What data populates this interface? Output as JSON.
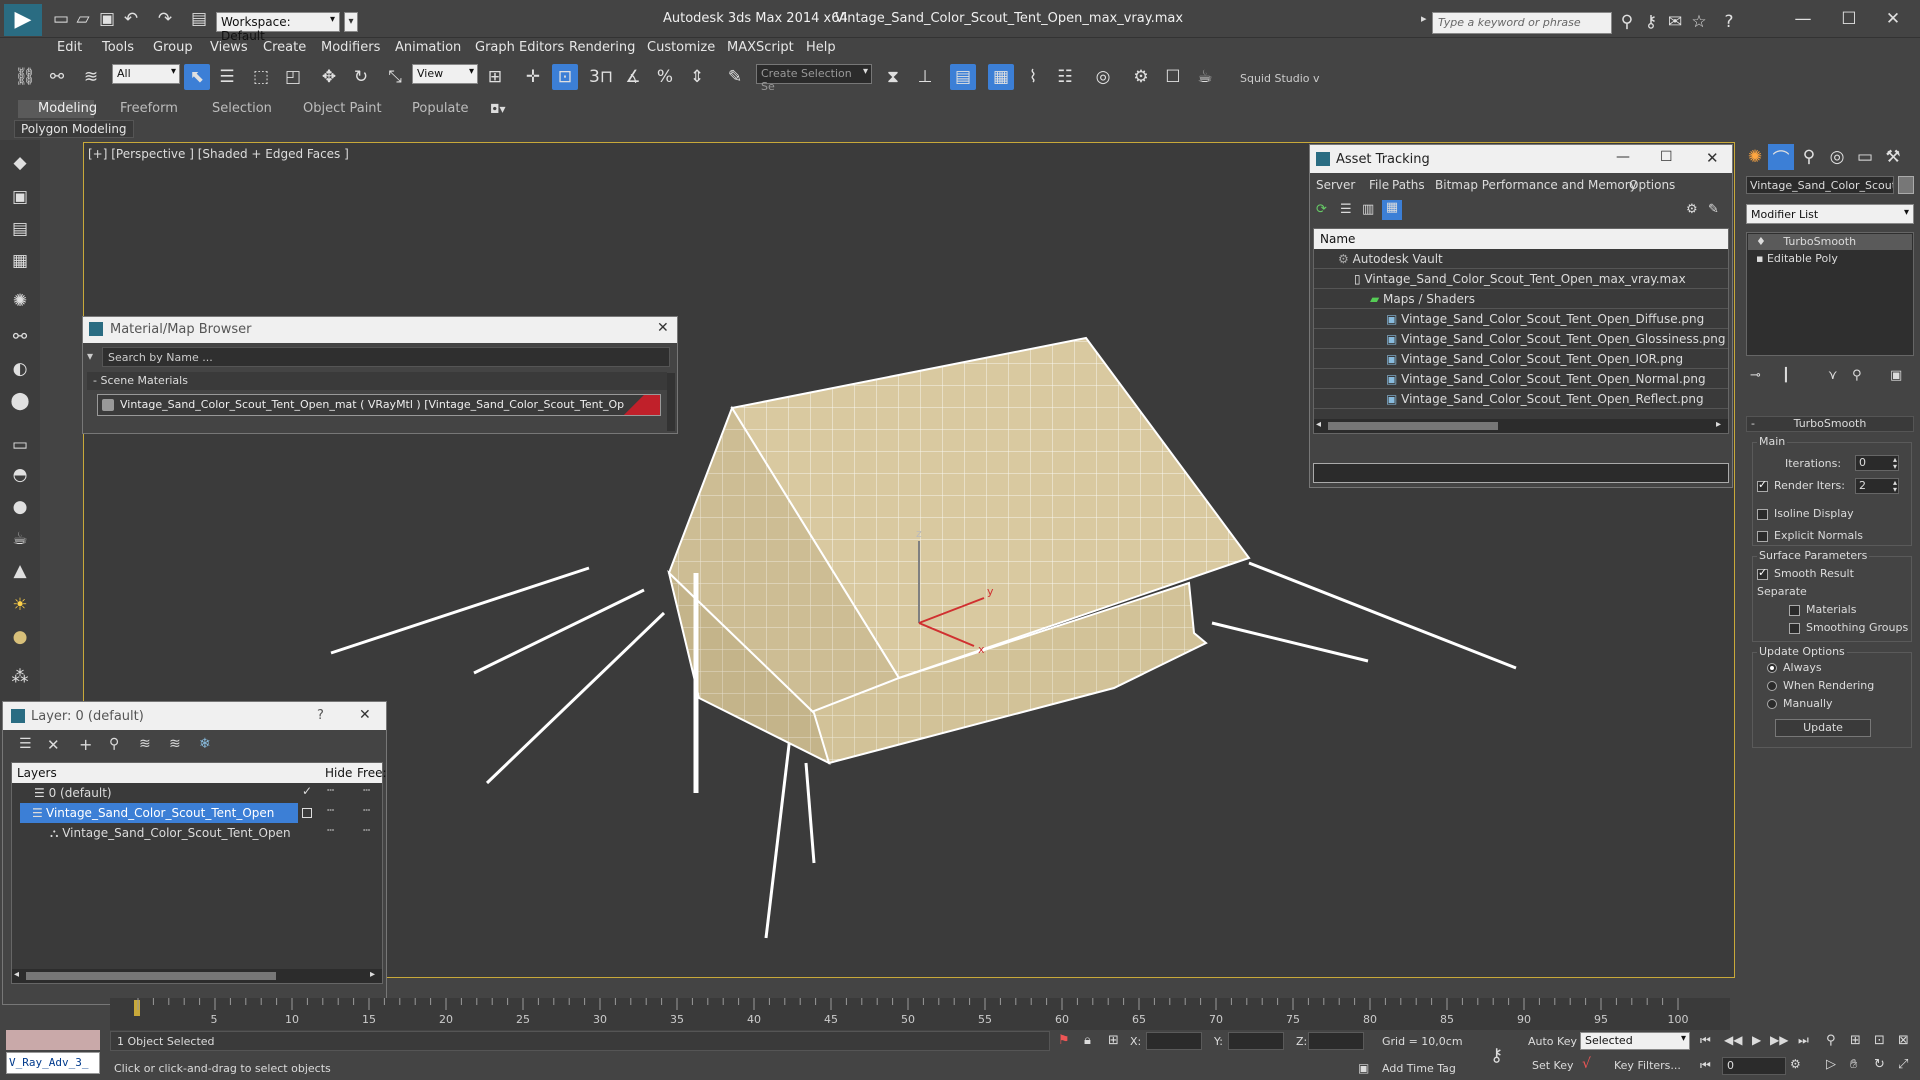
{
  "titlebar": {
    "workspace_label": "Workspace: Default",
    "app_title": "Autodesk 3ds Max  2014 x64",
    "file_title": "Vintage_Sand_Color_Scout_Tent_Open_max_vray.max",
    "search_placeholder": "Type a keyword or phrase"
  },
  "menu": [
    "Edit",
    "Tools",
    "Group",
    "Views",
    "Create",
    "Modifiers",
    "Animation",
    "Graph Editors",
    "Rendering",
    "Customize",
    "MAXScript",
    "Help"
  ],
  "toolbar": {
    "filter_value": "All",
    "coord_value": "View",
    "selection_set_placeholder": "Create Selection Se",
    "squid_label": "Squid Studio v"
  },
  "ribbon": {
    "tabs": [
      "Modeling",
      "Freeform",
      "Selection",
      "Object Paint",
      "Populate"
    ],
    "sub_label": "Polygon Modeling"
  },
  "viewport": {
    "label": "[+] [Perspective ] [Shaded + Edged Faces ]",
    "axis_z": "z",
    "axis_y": "y",
    "axis_x": "x"
  },
  "material_browser": {
    "title": "Material/Map Browser",
    "search_placeholder": "Search by Name ...",
    "section": "Scene Materials",
    "material_item": "Vintage_Sand_Color_Scout_Tent_Open_mat  ( VRayMtl )  [Vintage_Sand_Color_Scout_Tent_Open]"
  },
  "asset_tracking": {
    "title": "Asset Tracking",
    "menu": [
      "Server",
      "File",
      "Paths",
      "Bitmap Performance and Memory",
      "Options"
    ],
    "column_name": "Name",
    "rows": [
      {
        "label": "Autodesk Vault",
        "indent": 0
      },
      {
        "label": "Vintage_Sand_Color_Scout_Tent_Open_max_vray.max",
        "indent": 1
      },
      {
        "label": "Maps / Shaders",
        "indent": 2
      },
      {
        "label": "Vintage_Sand_Color_Scout_Tent_Open_Diffuse.png",
        "indent": 3
      },
      {
        "label": "Vintage_Sand_Color_Scout_Tent_Open_Glossiness.png",
        "indent": 3
      },
      {
        "label": "Vintage_Sand_Color_Scout_Tent_Open_IOR.png",
        "indent": 3
      },
      {
        "label": "Vintage_Sand_Color_Scout_Tent_Open_Normal.png",
        "indent": 3
      },
      {
        "label": "Vintage_Sand_Color_Scout_Tent_Open_Reflect.png",
        "indent": 3
      }
    ]
  },
  "layer_manager": {
    "title": "Layer: 0 (default)",
    "help": "?",
    "columns": [
      "Layers",
      "Hide",
      "Free:"
    ],
    "rows": [
      {
        "label": "0 (default)"
      },
      {
        "label": "Vintage_Sand_Color_Scout_Tent_Open"
      },
      {
        "label": "Vintage_Sand_Color_Scout_Tent_Open"
      }
    ]
  },
  "command_panel": {
    "object_name": "Vintage_Sand_Color_Scout_T",
    "modifier_list": "Modifier List",
    "stack": [
      "TurboSmooth",
      "Editable Poly"
    ],
    "rollout_title": "TurboSmooth",
    "main_label": "Main",
    "iterations_label": "Iterations:",
    "iterations_value": "0",
    "render_iters_label": "Render Iters:",
    "render_iters_value": "2",
    "isoline_label": "Isoline Display",
    "explicit_normals_label": "Explicit Normals",
    "surface_params_label": "Surface Parameters",
    "smooth_result_label": "Smooth Result",
    "separate_label": "Separate",
    "materials_label": "Materials",
    "smoothing_groups_label": "Smoothing Groups",
    "update_options_label": "Update Options",
    "always_label": "Always",
    "when_rendering_label": "When Rendering",
    "manually_label": "Manually",
    "update_button": "Update"
  },
  "timeline": {
    "ticks": [
      "5",
      "10",
      "15",
      "20",
      "25",
      "30",
      "35",
      "40",
      "45",
      "50",
      "55",
      "60",
      "65",
      "70",
      "75",
      "80",
      "85",
      "90",
      "95",
      "100"
    ]
  },
  "statusbar": {
    "script_label": "V_Ray_Adv_3_",
    "objects_selected": "1 Object Selected",
    "prompt": "Click or click-and-drag to select objects",
    "x_label": "X:",
    "y_label": "Y:",
    "z_label": "Z:",
    "grid": "Grid = 10,0cm",
    "add_time_tag": "Add Time Tag",
    "auto_key": "Auto Key",
    "set_key": "Set Key",
    "selected_value": "Selected",
    "key_filters": "Key Filters...",
    "frame_value": "0"
  },
  "colors": {
    "background": "#444444",
    "viewport": "#3b3b3b",
    "tent": "#d9c9a0",
    "accent_blue": "#3c7fd6",
    "material_swatch": "#c0202a"
  }
}
